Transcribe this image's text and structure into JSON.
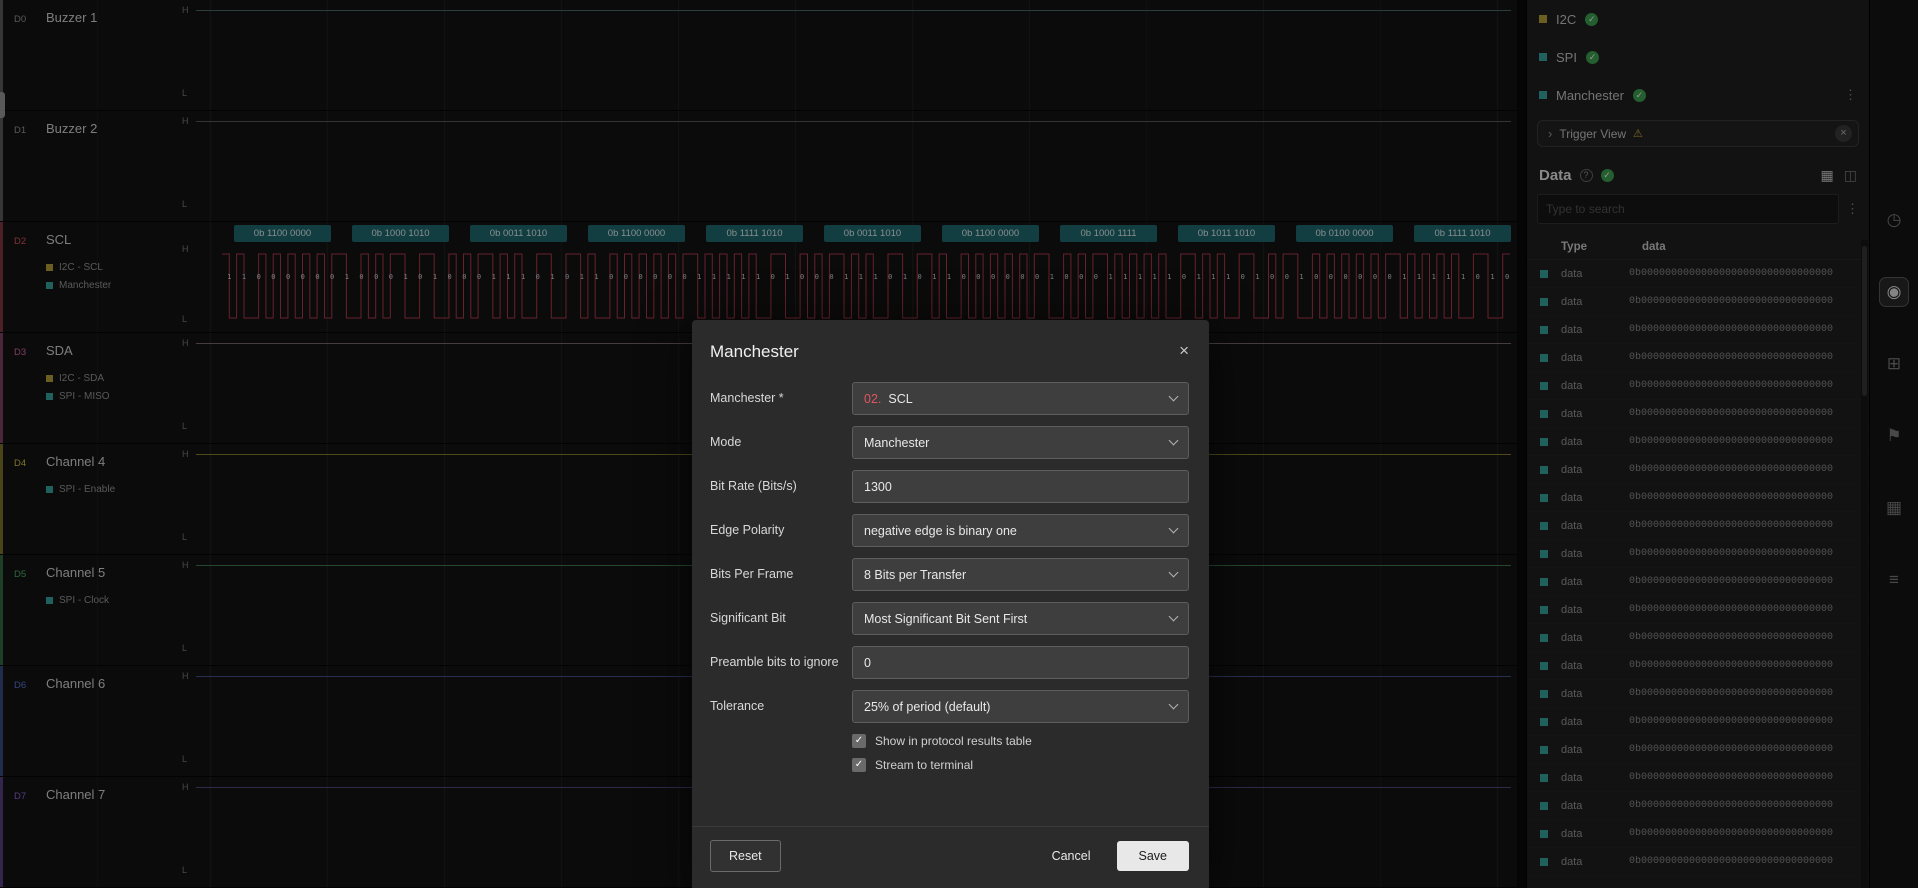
{
  "icons": {
    "check": "✓",
    "warning": "⚠",
    "close": "×",
    "chevron_right": "›",
    "kebab": "⋮",
    "question": "?",
    "grid": "▦",
    "panel": "◫"
  },
  "waveform": {
    "h_label": "H",
    "l_label": "L",
    "channels": [
      {
        "id": "D0",
        "name": "Buzzer 1",
        "color": "#9a9a9a",
        "line_color": "#4a6a6a",
        "wave": "flat",
        "subs": []
      },
      {
        "id": "D1",
        "name": "Buzzer 2",
        "color": "#9a9a9a",
        "line_color": "#5a5a5a",
        "wave": "flat",
        "subs": []
      },
      {
        "id": "D2",
        "name": "SCL",
        "color": "#e05561",
        "line_color": "#b23a4c",
        "wave": "manchester",
        "subs": [
          {
            "label": "I2C - SCL",
            "color": "#b8a23a"
          },
          {
            "label": "Manchester",
            "color": "#3aa8a0"
          }
        ]
      },
      {
        "id": "D3",
        "name": "SDA",
        "color": "#e06ca8",
        "line_color": "#7a6a70",
        "wave": "flat",
        "subs": [
          {
            "label": "I2C - SDA",
            "color": "#b8a23a"
          },
          {
            "label": "SPI - MISO",
            "color": "#3aa8a0"
          }
        ]
      },
      {
        "id": "D4",
        "name": "Channel 4",
        "color": "#d8c83c",
        "line_color": "#8a7f2e",
        "wave": "flat",
        "subs": [
          {
            "label": "SPI - Enable",
            "color": "#3aa8a0"
          }
        ]
      },
      {
        "id": "D5",
        "name": "Channel 5",
        "color": "#4fb36a",
        "line_color": "#3f7f52",
        "wave": "flat",
        "subs": [
          {
            "label": "SPI - Clock",
            "color": "#3aa8a0"
          }
        ]
      },
      {
        "id": "D6",
        "name": "Channel 6",
        "color": "#5a7ae0",
        "line_color": "#44548a",
        "wave": "flat",
        "subs": []
      },
      {
        "id": "D7",
        "name": "Channel 7",
        "color": "#8f6ae0",
        "line_color": "#55497f",
        "wave": "flat",
        "subs": []
      }
    ],
    "d2_tags": [
      "0b 1100 0000",
      "0b 1000 1010",
      "0b 0011 1010",
      "0b 1100 0000",
      "0b 1111 1010",
      "0b 0011 1010",
      "0b 1100 0000",
      "0b 1000 1111",
      "0b 1011 1010",
      "0b 0100 0000",
      "0b 1111 1010"
    ],
    "d2_bits": "1100000010001010001110101100000011111010001110101100000010001111101110100100000011111010",
    "tag_bg": "#1f6b72"
  },
  "sidebar": {
    "analyzers": [
      {
        "name": "I2C",
        "color": "#b8a23a",
        "menu": false
      },
      {
        "name": "SPI",
        "color": "#3aa8a0",
        "menu": false
      },
      {
        "name": "Manchester",
        "color": "#3aa8a0",
        "menu": true
      }
    ],
    "trigger_view_label": "Trigger View",
    "data_panel": {
      "title": "Data",
      "search_placeholder": "Type to search",
      "columns": [
        "Type",
        "data"
      ],
      "row_square_color": "#3aa8a0",
      "rows": [
        {
          "type": "data",
          "value": "0b00000000000000000000000000000000"
        },
        {
          "type": "data",
          "value": "0b00000000000000000000000000000000"
        },
        {
          "type": "data",
          "value": "0b00000000000000000000000000000000"
        },
        {
          "type": "data",
          "value": "0b00000000000000000000000000000000"
        },
        {
          "type": "data",
          "value": "0b00000000000000000000000000000000"
        },
        {
          "type": "data",
          "value": "0b00000000000000000000000000000000"
        },
        {
          "type": "data",
          "value": "0b00000000000000000000000000000000"
        },
        {
          "type": "data",
          "value": "0b00000000000000000000000000000000"
        },
        {
          "type": "data",
          "value": "0b00000000000000000000000000000000"
        },
        {
          "type": "data",
          "value": "0b00000000000000000000000000000000"
        },
        {
          "type": "data",
          "value": "0b00000000000000000000000000000000"
        },
        {
          "type": "data",
          "value": "0b00000000000000000000000000000000"
        },
        {
          "type": "data",
          "value": "0b00000000000000000000000000000000"
        },
        {
          "type": "data",
          "value": "0b00000000000000000000000000000000"
        },
        {
          "type": "data",
          "value": "0b00000000000000000000000000000000"
        },
        {
          "type": "data",
          "value": "0b00000000000000000000000000000000"
        },
        {
          "type": "data",
          "value": "0b00000000000000000000000000000000"
        },
        {
          "type": "data",
          "value": "0b00000000000000000000000000000000"
        },
        {
          "type": "data",
          "value": "0b00000000000000000000000000000000"
        },
        {
          "type": "data",
          "value": "0b00000000000000000000000000000000"
        },
        {
          "type": "data",
          "value": "0b00000000000000000000000000000000"
        },
        {
          "type": "data",
          "value": "0b00000000000000000000000000000000"
        }
      ]
    }
  },
  "toolstrip": {
    "icons": [
      {
        "name": "measurements-icon",
        "glyph": "◷",
        "active": false
      },
      {
        "name": "analyzers-icon",
        "glyph": "◉",
        "active": true
      },
      {
        "name": "capture-settings-icon",
        "glyph": "⊞",
        "active": false
      },
      {
        "name": "annotations-icon",
        "glyph": "⚑",
        "active": false
      },
      {
        "name": "extensions-icon",
        "glyph": "▦",
        "active": false
      },
      {
        "name": "terminal-icon",
        "glyph": "≡",
        "active": false
      }
    ]
  },
  "modal": {
    "title": "Manchester",
    "fields": [
      {
        "label": "Manchester *",
        "type": "select",
        "prefix": "02.",
        "value": "SCL"
      },
      {
        "label": "Mode",
        "type": "select",
        "value": "Manchester"
      },
      {
        "label": "Bit Rate (Bits/s)",
        "type": "input",
        "value": "1300"
      },
      {
        "label": "Edge Polarity",
        "type": "select",
        "value": "negative edge is binary one"
      },
      {
        "label": "Bits Per Frame",
        "type": "select",
        "value": "8 Bits per Transfer"
      },
      {
        "label": "Significant Bit",
        "type": "select",
        "value": "Most Significant Bit Sent First"
      },
      {
        "label": "Preamble bits to ignore",
        "type": "input",
        "value": "0"
      },
      {
        "label": "Tolerance",
        "type": "select",
        "value": "25% of period (default)"
      }
    ],
    "checkboxes": [
      {
        "label": "Show in protocol results table",
        "checked": true
      },
      {
        "label": "Stream to terminal",
        "checked": true
      }
    ],
    "buttons": {
      "reset": "Reset",
      "cancel": "Cancel",
      "save": "Save"
    }
  }
}
